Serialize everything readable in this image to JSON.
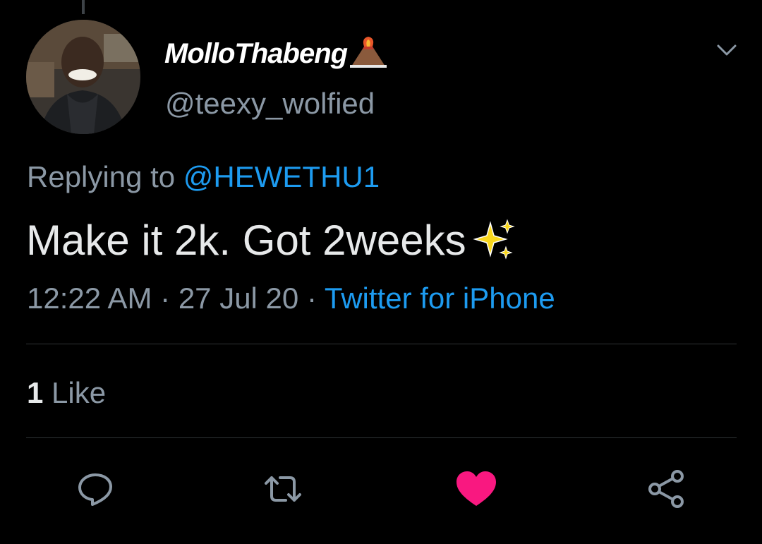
{
  "tweet": {
    "display_name": "MolloThabeng",
    "handle": "@teexy_wolfied",
    "reply_prefix": "Replying to",
    "reply_mention": "@HEWETHU1",
    "text": "Make it 2k. Got 2weeks",
    "time": "12:22 AM",
    "separator": "·",
    "date": "27 Jul 20",
    "source": "Twitter for iPhone",
    "like_count": "1",
    "like_label": "Like"
  },
  "icons": {
    "name_emoji": "volcano-icon",
    "text_emoji": "sparkles-icon",
    "menu": "chevron-down-icon",
    "reply": "comment-icon",
    "retweet": "retweet-icon",
    "like": "heart-icon",
    "share": "share-icon"
  },
  "colors": {
    "background": "#000000",
    "link": "#1d9bf0",
    "secondary_text": "#8b98a5",
    "primary_text": "#e7e9ea",
    "like_active": "#f91880"
  }
}
